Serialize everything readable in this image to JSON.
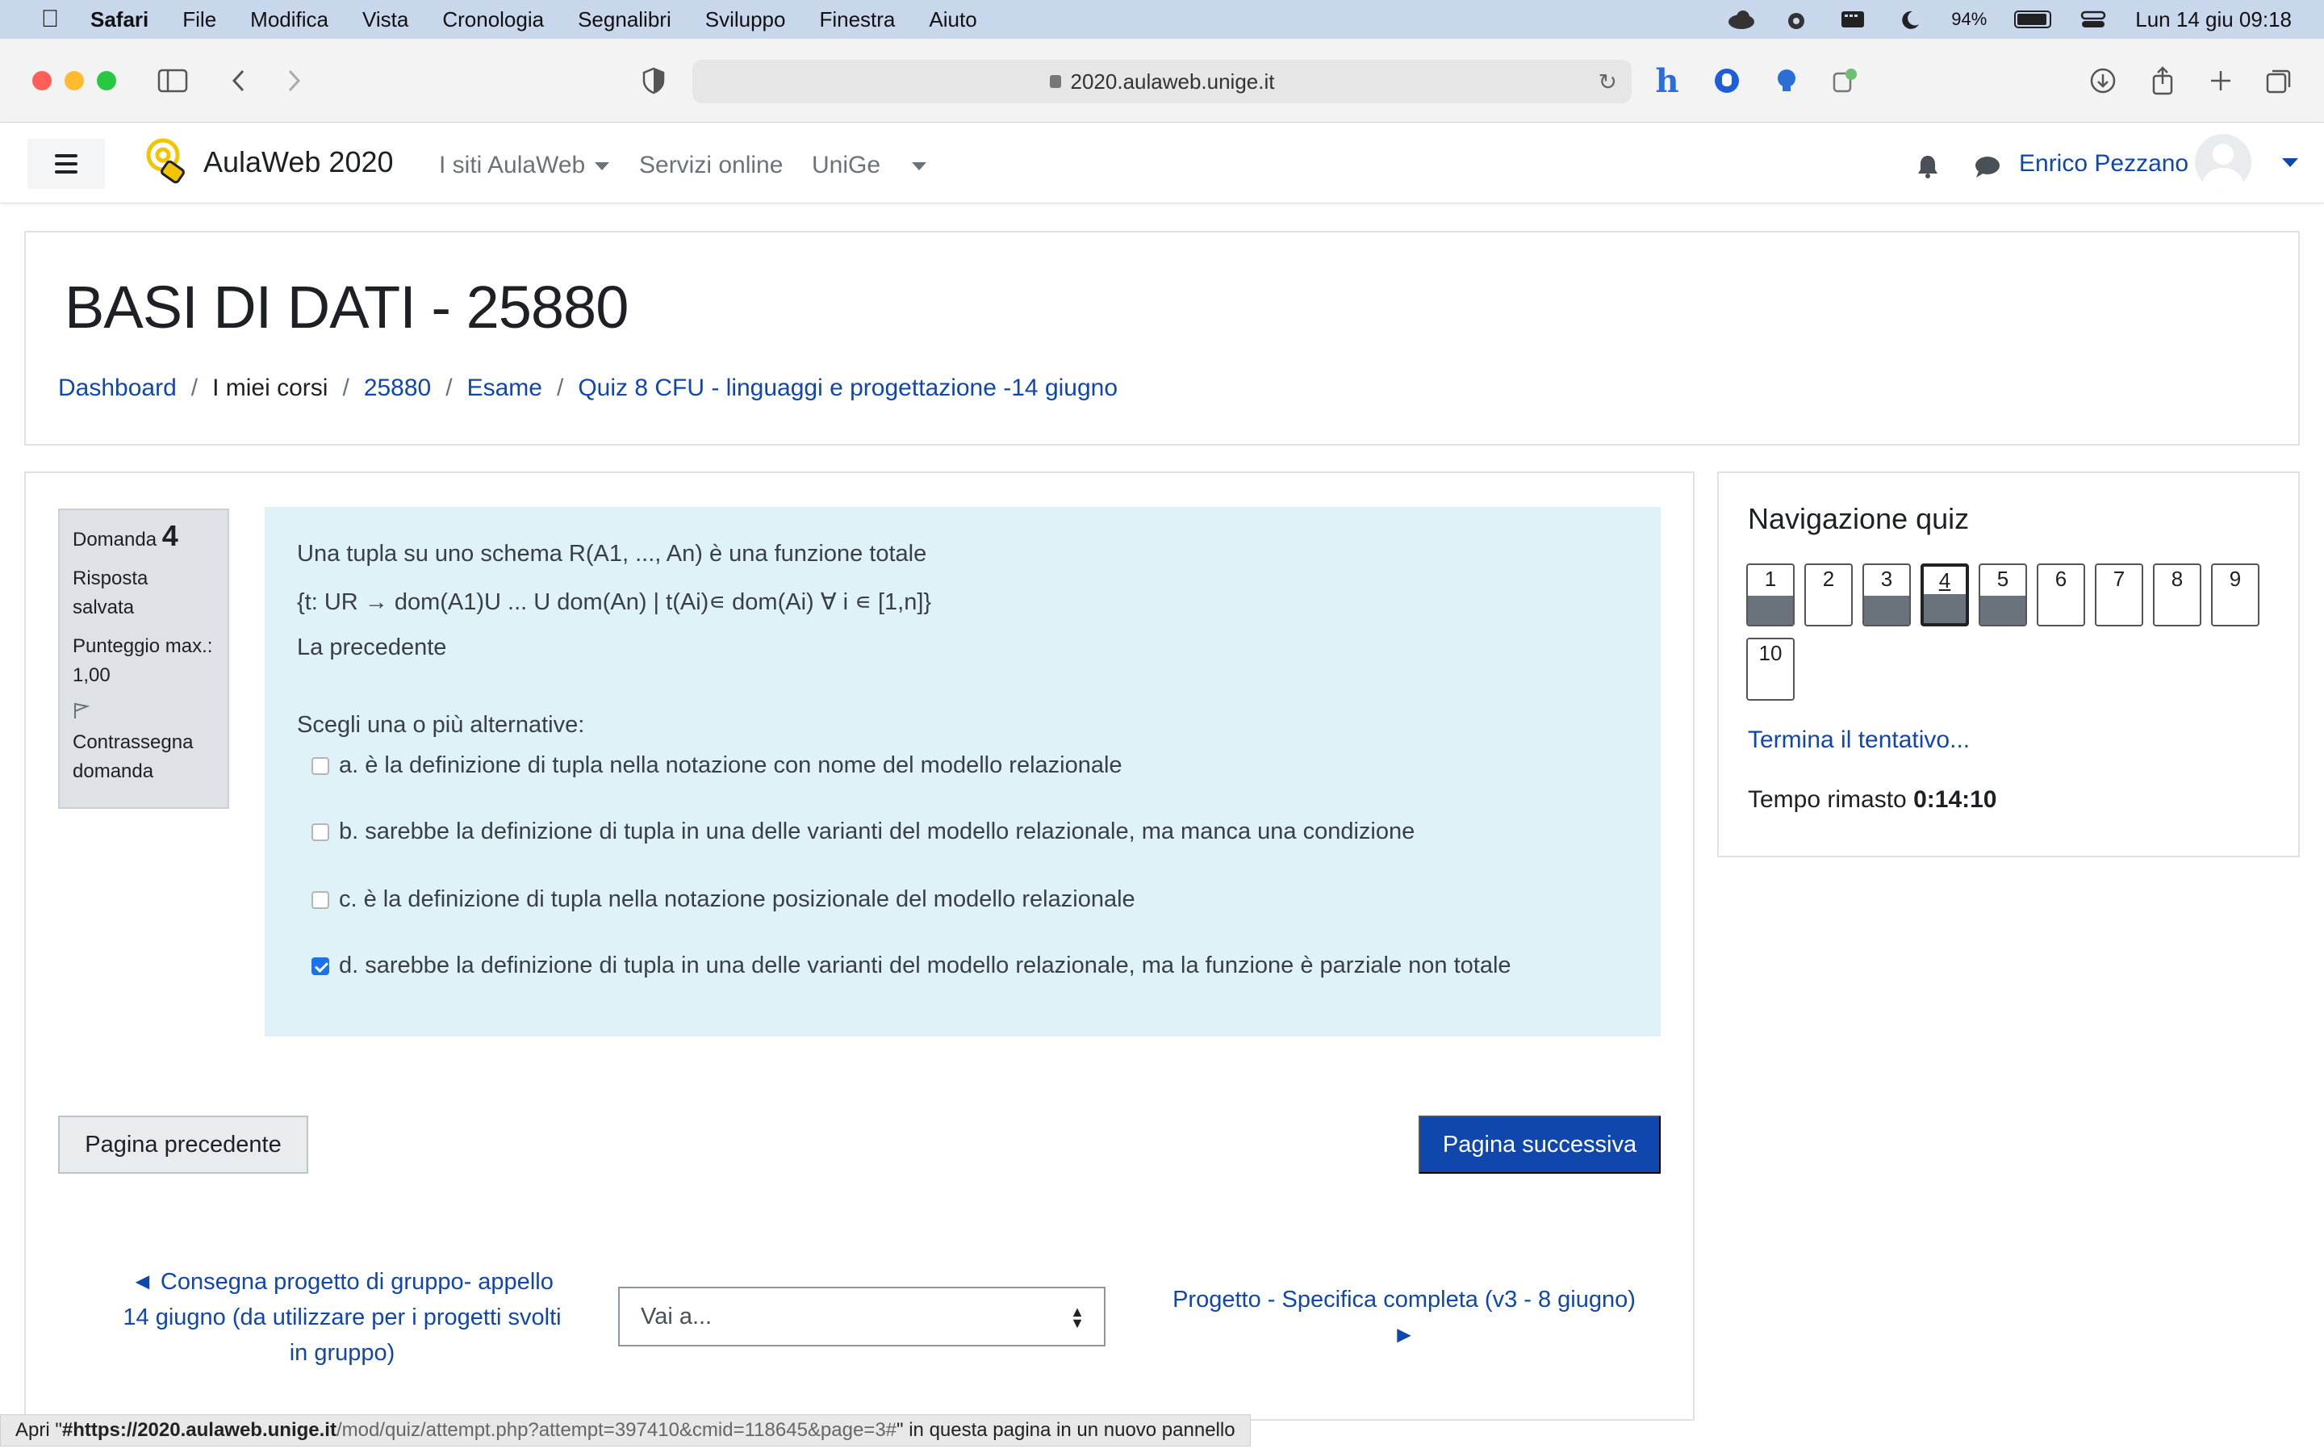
{
  "menubar": {
    "app": "Safari",
    "items": [
      "File",
      "Modifica",
      "Vista",
      "Cronologia",
      "Segnalibri",
      "Sviluppo",
      "Finestra",
      "Aiuto"
    ],
    "battery": "94%",
    "datetime": "Lun 14 giu  09:18"
  },
  "browser": {
    "url": "2020.aulaweb.unige.it"
  },
  "navbar": {
    "site_name": "AulaWeb 2020",
    "links": [
      "I siti AulaWeb",
      "Servizi online",
      "UniGe"
    ],
    "user_name": "Enrico Pezzano"
  },
  "header": {
    "course_title": "BASI DI DATI - 25880",
    "breadcrumb": [
      "Dashboard",
      "I miei corsi",
      "25880",
      "Esame",
      "Quiz 8 CFU - linguaggi e progettazione -14 giugno"
    ]
  },
  "question": {
    "label": "Domanda",
    "number": "4",
    "status": "Risposta salvata",
    "max_score": "Punteggio max.: 1,00",
    "flag_label": "Contrassegna domanda",
    "text_line1": "Una tupla su uno schema R(A1, ..., An) è una funzione totale",
    "text_line2": "{t: UR → dom(A1)U ... U dom(An) | t(Ai)∊ dom(Ai) ∀ i ∊ [1,n]}",
    "text_line3": "La precedente",
    "prompt": "Scegli una o più alternative:",
    "options": [
      {
        "label": "a. è la definizione di tupla nella notazione con nome del modello relazionale",
        "checked": false
      },
      {
        "label": "b. sarebbe la definizione di tupla in una delle varianti del modello relazionale, ma manca una condizione",
        "checked": false
      },
      {
        "label": "c. è la definizione di tupla nella notazione posizionale del modello relazionale",
        "checked": false
      },
      {
        "label": "d. sarebbe la definizione di tupla in una delle varianti del modello relazionale, ma la funzione è parziale non totale",
        "checked": true
      }
    ]
  },
  "buttons": {
    "prev": "Pagina precedente",
    "next": "Pagina successiva"
  },
  "activity_nav": {
    "prev": "◄ Consegna progetto di gruppo- appello 14 giugno (da utilizzare per i progetti svolti in gruppo)",
    "jump_placeholder": "Vai a...",
    "next": "Progetto - Specifica completa (v3 - 8 giugno) ►"
  },
  "quiz_nav": {
    "title": "Navigazione quiz",
    "questions": [
      {
        "n": "1",
        "answered": true,
        "current": false
      },
      {
        "n": "2",
        "answered": false,
        "current": false
      },
      {
        "n": "3",
        "answered": true,
        "current": false
      },
      {
        "n": "4",
        "answered": true,
        "current": true
      },
      {
        "n": "5",
        "answered": true,
        "current": false
      },
      {
        "n": "6",
        "answered": false,
        "current": false
      },
      {
        "n": "7",
        "answered": false,
        "current": false
      },
      {
        "n": "8",
        "answered": false,
        "current": false
      },
      {
        "n": "9",
        "answered": false,
        "current": false
      },
      {
        "n": "10",
        "answered": false,
        "current": false
      }
    ],
    "finish": "Termina il tentativo...",
    "time_label": "Tempo rimasto",
    "time_value": "0:14:10"
  },
  "statusbar": {
    "prefix": "Apri \"",
    "url_host": "#https://2020.aulaweb.unige.it",
    "url_path": "/mod/quiz/attempt.php?attempt=397410&cmid=118645&page=3#",
    "suffix": "\" in questa pagina in un nuovo pannello"
  },
  "colors": {
    "link": "#0f47ad",
    "question_bg": "#def2f8",
    "primary_button": "#0f47ad"
  }
}
